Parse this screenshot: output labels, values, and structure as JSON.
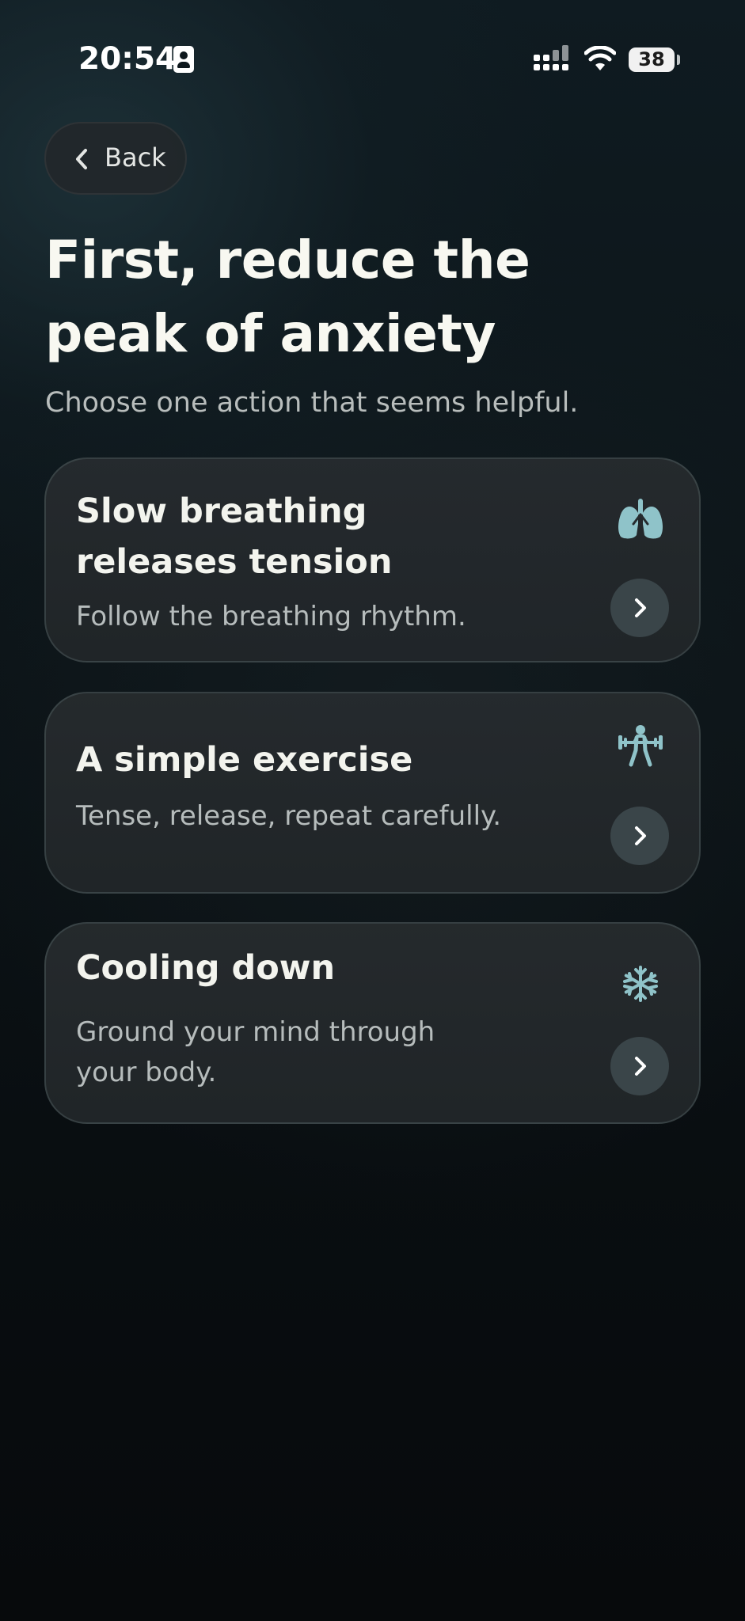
{
  "status_bar": {
    "time": "20:54",
    "battery": "38"
  },
  "header": {
    "back_label": "Back"
  },
  "main": {
    "title": "First, reduce the peak of anxiety",
    "subtitle": "Choose one action that seems helpful.",
    "options": [
      {
        "title": "Slow breathing releases tension",
        "description": "Follow the breathing rhythm.",
        "icon": "lungs-icon"
      },
      {
        "title": "A simple exercise",
        "description": "Tense, release, repeat carefully.",
        "icon": "weightlifting-icon"
      },
      {
        "title": "Cooling down",
        "description": "Ground your mind through your body.",
        "icon": "snowflake-icon"
      }
    ]
  },
  "colors": {
    "accent_icon": "#8fc3c9",
    "card_bg": "#262b2e",
    "background": "#0c1418"
  }
}
